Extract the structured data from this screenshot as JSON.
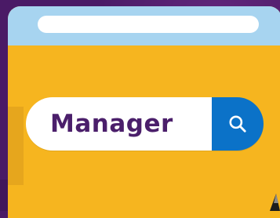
{
  "search": {
    "value": "Manager",
    "icon": "magnifier-icon"
  },
  "colors": {
    "background": "#4a1a66",
    "window": "#f6b51f",
    "window_bar": "#a7d4f0",
    "search_button": "#0b72c8",
    "text": "#4b1f6b"
  }
}
